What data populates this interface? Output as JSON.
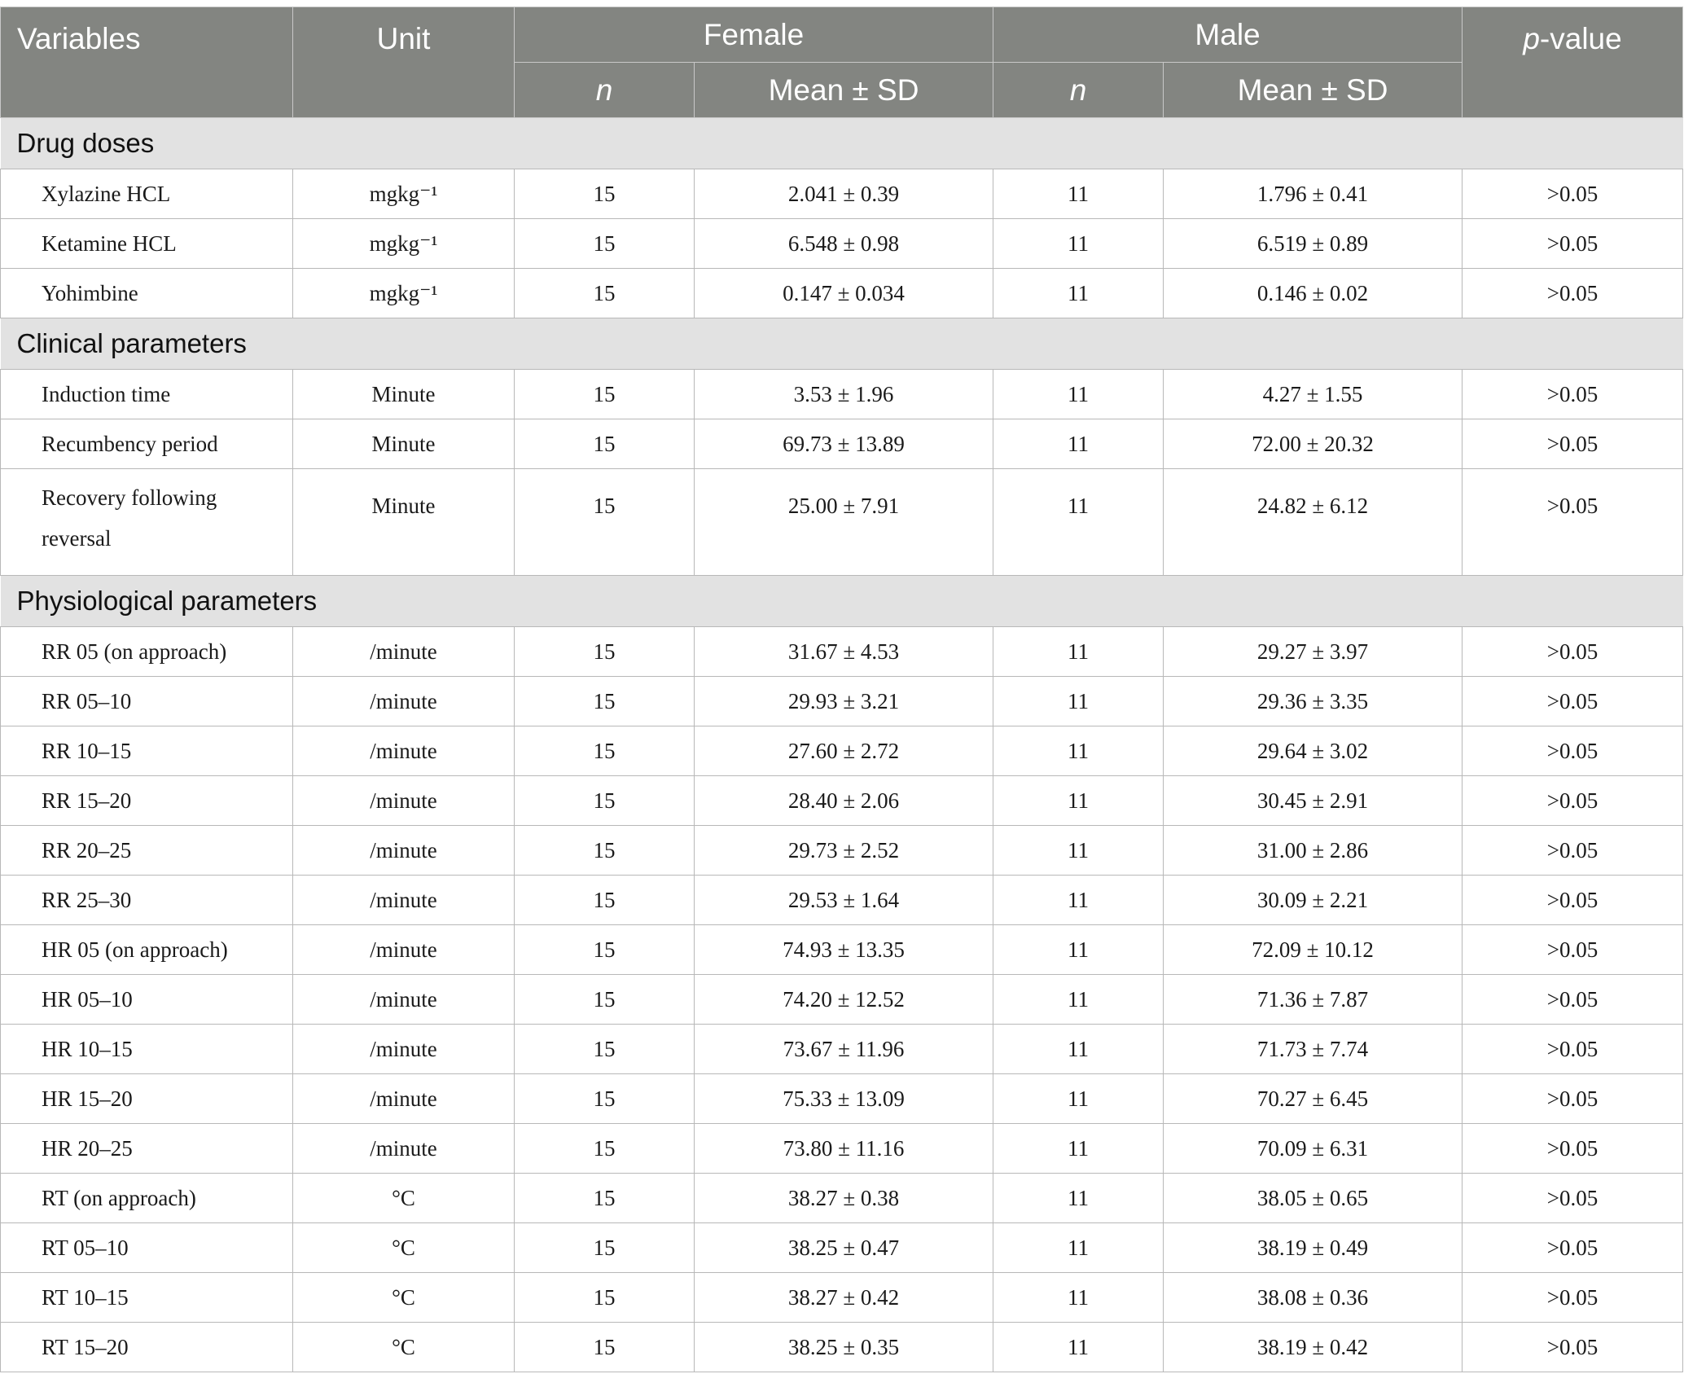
{
  "header": {
    "variables": "Variables",
    "unit": "Unit",
    "female": "Female",
    "male": "Male",
    "p_prefix": "p",
    "p_suffix": "-value",
    "n": "n",
    "mean_sd": "Mean ± SD"
  },
  "sections": [
    {
      "title": "Drug doses",
      "rows": [
        {
          "variable": "Xylazine HCL",
          "unit": "mgkg⁻¹",
          "f_n": "15",
          "f_mean": "2.041 ± 0.39",
          "m_n": "11",
          "m_mean": "1.796 ± 0.41",
          "p": ">0.05"
        },
        {
          "variable": "Ketamine HCL",
          "unit": "mgkg⁻¹",
          "f_n": "15",
          "f_mean": "6.548 ± 0.98",
          "m_n": "11",
          "m_mean": "6.519 ± 0.89",
          "p": ">0.05"
        },
        {
          "variable": "Yohimbine",
          "unit": "mgkg⁻¹",
          "f_n": "15",
          "f_mean": "0.147 ± 0.034",
          "m_n": "11",
          "m_mean": "0.146 ± 0.02",
          "p": ">0.05"
        }
      ]
    },
    {
      "title": "Clinical parameters",
      "rows": [
        {
          "variable": "Induction time",
          "unit": "Minute",
          "f_n": "15",
          "f_mean": "3.53 ± 1.96",
          "m_n": "11",
          "m_mean": "4.27 ± 1.55",
          "p": ">0.05"
        },
        {
          "variable": "Recumbency period",
          "unit": "Minute",
          "f_n": "15",
          "f_mean": "69.73 ± 13.89",
          "m_n": "11",
          "m_mean": "72.00 ± 20.32",
          "p": ">0.05"
        },
        {
          "variable": "Recovery following reversal",
          "unit": "Minute",
          "f_n": "15",
          "f_mean": "25.00 ± 7.91",
          "m_n": "11",
          "m_mean": "24.82 ± 6.12",
          "p": ">0.05",
          "tall": true
        }
      ]
    },
    {
      "title": "Physiological parameters",
      "rows": [
        {
          "variable": "RR 05 (on approach)",
          "unit": "/minute",
          "f_n": "15",
          "f_mean": "31.67 ± 4.53",
          "m_n": "11",
          "m_mean": "29.27 ± 3.97",
          "p": ">0.05"
        },
        {
          "variable": "RR 05–10",
          "unit": "/minute",
          "f_n": "15",
          "f_mean": "29.93 ± 3.21",
          "m_n": "11",
          "m_mean": "29.36 ± 3.35",
          "p": ">0.05"
        },
        {
          "variable": "RR 10–15",
          "unit": "/minute",
          "f_n": "15",
          "f_mean": "27.60 ± 2.72",
          "m_n": "11",
          "m_mean": "29.64 ± 3.02",
          "p": ">0.05"
        },
        {
          "variable": "RR 15–20",
          "unit": "/minute",
          "f_n": "15",
          "f_mean": "28.40 ± 2.06",
          "m_n": "11",
          "m_mean": "30.45 ± 2.91",
          "p": ">0.05"
        },
        {
          "variable": "RR 20–25",
          "unit": "/minute",
          "f_n": "15",
          "f_mean": "29.73 ± 2.52",
          "m_n": "11",
          "m_mean": "31.00 ± 2.86",
          "p": ">0.05"
        },
        {
          "variable": "RR 25–30",
          "unit": "/minute",
          "f_n": "15",
          "f_mean": "29.53 ± 1.64",
          "m_n": "11",
          "m_mean": "30.09 ± 2.21",
          "p": ">0.05"
        },
        {
          "variable": "HR 05 (on approach)",
          "unit": "/minute",
          "f_n": "15",
          "f_mean": "74.93 ± 13.35",
          "m_n": "11",
          "m_mean": "72.09 ± 10.12",
          "p": ">0.05"
        },
        {
          "variable": "HR 05–10",
          "unit": "/minute",
          "f_n": "15",
          "f_mean": "74.20 ± 12.52",
          "m_n": "11",
          "m_mean": "71.36 ± 7.87",
          "p": ">0.05"
        },
        {
          "variable": "HR 10–15",
          "unit": "/minute",
          "f_n": "15",
          "f_mean": "73.67 ± 11.96",
          "m_n": "11",
          "m_mean": "71.73 ± 7.74",
          "p": ">0.05"
        },
        {
          "variable": "HR 15–20",
          "unit": "/minute",
          "f_n": "15",
          "f_mean": "75.33 ± 13.09",
          "m_n": "11",
          "m_mean": "70.27 ± 6.45",
          "p": ">0.05"
        },
        {
          "variable": "HR 20–25",
          "unit": "/minute",
          "f_n": "15",
          "f_mean": "73.80 ± 11.16",
          "m_n": "11",
          "m_mean": "70.09 ± 6.31",
          "p": ">0.05"
        },
        {
          "variable": "RT (on approach)",
          "unit": "°C",
          "f_n": "15",
          "f_mean": "38.27 ± 0.38",
          "m_n": "11",
          "m_mean": "38.05 ± 0.65",
          "p": ">0.05"
        },
        {
          "variable": "RT 05–10",
          "unit": "°C",
          "f_n": "15",
          "f_mean": "38.25 ± 0.47",
          "m_n": "11",
          "m_mean": "38.19 ± 0.49",
          "p": ">0.05"
        },
        {
          "variable": "RT 10–15",
          "unit": "°C",
          "f_n": "15",
          "f_mean": "38.27 ± 0.42",
          "m_n": "11",
          "m_mean": "38.08 ± 0.36",
          "p": ">0.05"
        },
        {
          "variable": "RT 15–20",
          "unit": "°C",
          "f_n": "15",
          "f_mean": "38.25 ± 0.35",
          "m_n": "11",
          "m_mean": "38.19 ± 0.42",
          "p": ">0.05"
        }
      ]
    }
  ]
}
